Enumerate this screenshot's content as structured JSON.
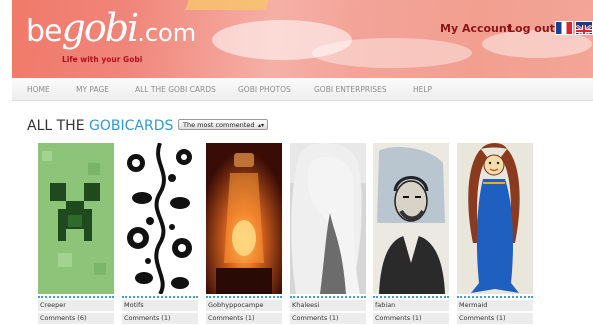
{
  "header": {
    "logo_be": "be",
    "logo_gobi": "gobi",
    "logo_com": ".com",
    "tagline": "Life with your Gobi",
    "my_account": "My Account",
    "log_out": "Log out",
    "flags": [
      "french-flag-icon",
      "uk-flag-icon"
    ]
  },
  "nav": {
    "items": [
      "HOME",
      "MY PAGE",
      "ALL THE GOBI CARDS",
      "GOBI PHOTOS",
      "GOBI ENTERPRISES",
      "HELP"
    ]
  },
  "main": {
    "title_a": "ALL THE ",
    "title_b": "GOBICARDS",
    "sort_value": "The most commented",
    "cards": [
      {
        "name": "Creeper",
        "comments": "Comments (6)"
      },
      {
        "name": "Motifs",
        "comments": "Comments (1)"
      },
      {
        "name": "Gobhyppocampe",
        "comments": "Comments (1)"
      },
      {
        "name": "Khaleesi",
        "comments": "Comments (1)"
      },
      {
        "name": "fabian",
        "comments": "Comments (1)"
      },
      {
        "name": "Mermaid",
        "comments": "Comments (1)"
      }
    ]
  },
  "colors": {
    "accent": "#2f9ad0",
    "account_text": "#8a1818",
    "header_pink": "#f29f90"
  }
}
